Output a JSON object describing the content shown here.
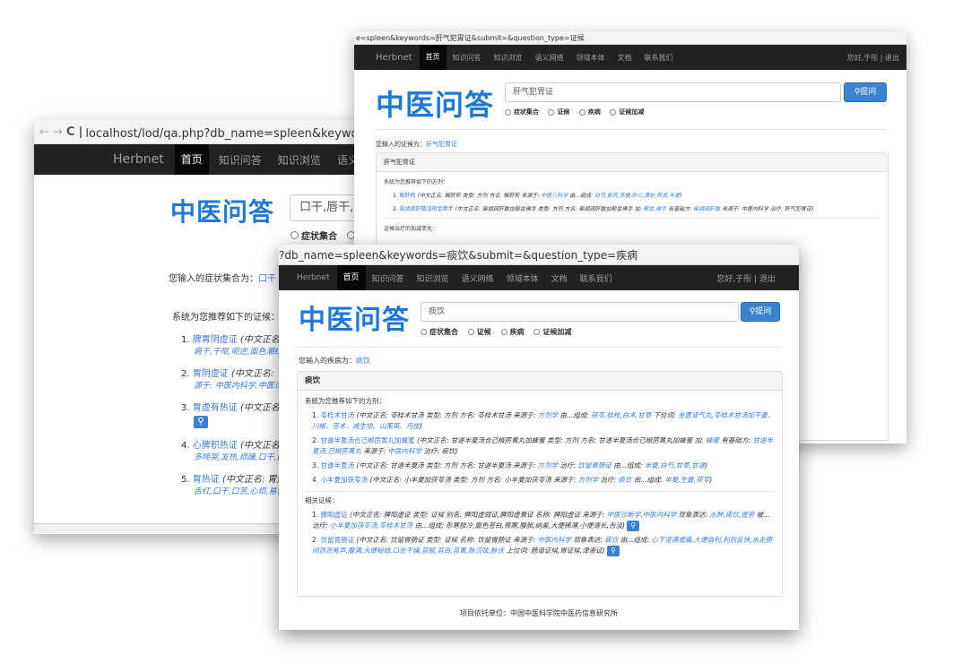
{
  "back": {
    "url": "localhost/lod/qa.php?db_name=spleen&keywords=口",
    "nav": [
      "首页",
      "知识问答",
      "知识浏览",
      "语义网络"
    ],
    "brand": "Herbnet",
    "logo": "中医问答",
    "search_value": "口干,唇干,于",
    "radio_label": "症状集合",
    "input_prefix": "您输入的症状集合为：",
    "input_value": "口干",
    "rec_title": "系统为您推荐如下的证候：",
    "items": [
      {
        "n": "1.",
        "name": "脾胃阴虚证",
        "rest": "(中文正名:",
        "line2": "肩干,干呕,呃逆,面色潮红,"
      },
      {
        "n": "2.",
        "name": "胃阴虚证",
        "rest": "(中文正名:",
        "line2": "源于: 中医内科学,中医诊断"
      },
      {
        "n": "3.",
        "name": "胃虚有热证",
        "rest": "(中文正名:",
        "line2": ""
      },
      {
        "n": "4.",
        "name": "心脾积热证",
        "rest": "(中文正名:",
        "line2": "多啼哭,发热,烦躁,口干,口舌"
      },
      {
        "n": "5.",
        "name": "胃热证",
        "rest": "(中文正名: 胃热证",
        "line2": "舌红,口干,口苦,心烦,易饥,"
      }
    ]
  },
  "mid": {
    "url": "e=spleen&keywords=肝气犯胃证&submit=&question_type=证候",
    "brand": "Herbnet",
    "nav": [
      "首页",
      "知识问答",
      "知识浏览",
      "语义网络",
      "领域本体",
      "文档",
      "联系我们"
    ],
    "user": "您好,于彤 | 退出",
    "logo": "中医问答",
    "search_value": "肝气犯胃证",
    "search_btn": "提问",
    "radios": [
      "症状集合",
      "证候",
      "疾病",
      "证候加减"
    ],
    "input_prefix": "您输入的证候为：",
    "input_value": "肝气犯胃证",
    "panel_title": "肝气犯胃证",
    "rec_title": "系统为您推荐如下的方剂：",
    "items": [
      {
        "n": "1.",
        "name": "解肝煎",
        "rest": "(中文正名: 解肝煎 类型: 方剂 方名: 解肝煎 来源于: ",
        "src": "中医儿科学",
        "mid": " 由...组成: ",
        "herbs": "白芍,紫苏,苏梗,砂仁,厚朴,陈皮,半夏",
        "end": ")"
      },
      {
        "n": "2.",
        "name": "柴胡疏肝散加郁金佛手",
        "rest": "(中文正名: 柴胡疏肝散加郁金佛手 类型: 方剂 方名: 柴胡疏肝散加郁金佛手 加: ",
        "src": "郁金,佛手",
        "mid": " 有基础方: ",
        "herbs": "柴胡疏肝散",
        "end": " 来源于: 中医内科学 治疗: 肝气犯胃证)"
      }
    ],
    "modifier_title": "证候治疗的加减变化："
  },
  "front": {
    "url": "?db_name=spleen&keywords=痰饮&submit=&question_type=疾病",
    "brand": "Herbnet",
    "nav": [
      "首页",
      "知识问答",
      "知识浏览",
      "语义网络",
      "领域本体",
      "文档",
      "联系我们"
    ],
    "user": "您好,于彤 | 退出",
    "logo": "中医问答",
    "search_value": "痰饮",
    "search_btn": "提问",
    "radios": [
      "症状集合",
      "证候",
      "疾病",
      "证候加减"
    ],
    "input_prefix": "您输入的疾病为：",
    "input_value": "痰饮",
    "panel_title": "痰饮",
    "rec_title": "系统为您推荐如下的方剂：",
    "formulas": [
      {
        "n": "1.",
        "name": "苓桂术甘汤",
        "text": "(中文正名: 苓桂术甘汤 类型: 方剂 方名: 苓桂术甘汤 来源于: ",
        "src": "方剂学",
        "mid": " 由...组成: ",
        "herbs": "茯苓,桂枝,白术,甘草",
        "tail": " 下位词: ",
        "extra": "金匮肾气丸,苓桂术甘汤加干姜、川椒、苍术，减生地、山茱萸、丹皮",
        "end": ")"
      },
      {
        "n": "2.",
        "name": "甘遂半夏汤合己椒苈黄丸加蜂蜜",
        "text": "(中文正名: 甘遂半夏汤合己椒苈黄丸加蜂蜜 类型: 方剂 方名: 甘遂半夏汤合己椒苈黄丸加蜂蜜 加: ",
        "src": "蜂蜜",
        "mid": " 有基础方: ",
        "herbs": "甘遂半夏汤,己椒苈黄丸",
        "tail": " 来源于: ",
        "extra": "中医内科学",
        "end": " 治疗: 痰饮)"
      },
      {
        "n": "3.",
        "name": "甘遂半夏汤",
        "text": "(中文正名: 甘遂半夏汤 类型: 方剂 方名: 甘遂半夏汤 来源于: ",
        "src": "方剂学",
        "mid": " 治疗: ",
        "herbs": "饮留胃肠证",
        "tail": " 由...组成: ",
        "extra": "半夏,白芍,甘草,甘遂",
        "end": ")"
      },
      {
        "n": "4.",
        "name": "小半夏加茯苓汤",
        "text": "(中文正名: 小半夏加茯苓汤 类型: 方剂 方名: 小半夏加茯苓汤 来源于: ",
        "src": "方剂学",
        "mid": " 治疗: ",
        "herbs": "痰饮",
        "tail": " 由...组成: ",
        "extra": "半夏,生姜,茯苓",
        "end": ")"
      }
    ],
    "related_title": "相关证候：",
    "syndromes": [
      {
        "n": "1.",
        "name": "脾阳虚证",
        "text": "(中文正名: 脾阳虚证 类型: 证候 别名: 脾阳虚弱证,脾阳虚衰证 名称: 脾阳虚证 来源于: ",
        "src": "中医诊断学,中医内科学",
        "mid": " 现象表达: ",
        "herbs": "水肿,痰饮,虚劳",
        "tail": " 被...治疗: ",
        "extra": "小半夏加茯苓汤,苓桂术甘汤",
        "end": " 由...组成: 形寒肢冷,面色苍白,畏寒,腹胀,纳差,大便稀薄,小便清长,舌淡)"
      },
      {
        "n": "2.",
        "name": "饮留胃肠证",
        "text": "(中文正名: 饮留胃肠证 类型: 证候 名称: 饮留胃肠证 来源于: ",
        "src": "中医内科学",
        "mid": " 现象表达: ",
        "herbs": "痰饮",
        "tail": " 由...组成: ",
        "extra": "心下坚满或痛,大便自利,利后反快,水走肠间沥沥有声,腹满,大便秘结,口舌干燥,苔腻,苔白,苔黄,脉沉弦,脉伏",
        "end": " 上位词: 肠道证候,胃证候,津液证)"
      }
    ],
    "footer": "项目依托单位：中国中医科学院中医药信息研究所"
  }
}
